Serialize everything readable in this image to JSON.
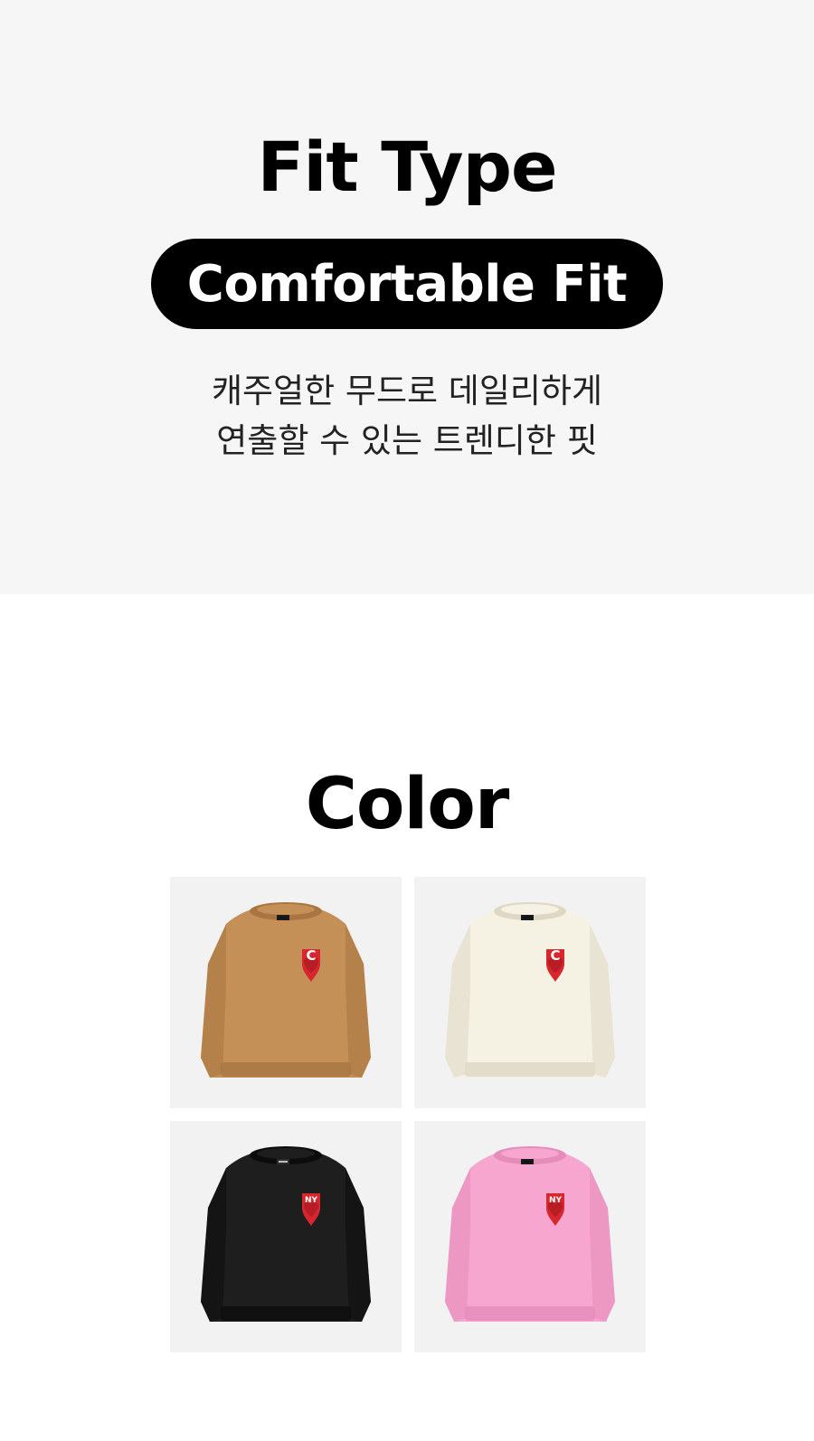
{
  "fit": {
    "title": "Fit Type",
    "pill_label": "Comfortable Fit",
    "description_line1": "캐주얼한 무드로 데일리하게",
    "description_line2": "연출할 수 있는 트렌디한 핏"
  },
  "color": {
    "title": "Color",
    "swatches": [
      {
        "name": "camel",
        "body": "#c49058",
        "shade": "#a87542",
        "patch": "C"
      },
      {
        "name": "ivory",
        "body": "#f5f1e3",
        "shade": "#ddd7c4",
        "patch": "C"
      },
      {
        "name": "black",
        "body": "#1e1e1e",
        "shade": "#0c0c0c",
        "patch": "NY"
      },
      {
        "name": "pink",
        "body": "#f6a6cf",
        "shade": "#e58cb9",
        "patch": "NY"
      }
    ]
  },
  "colors": {
    "fit_bg": "#f6f6f6",
    "pill_bg": "#000000",
    "patch_red": "#d7262e"
  }
}
